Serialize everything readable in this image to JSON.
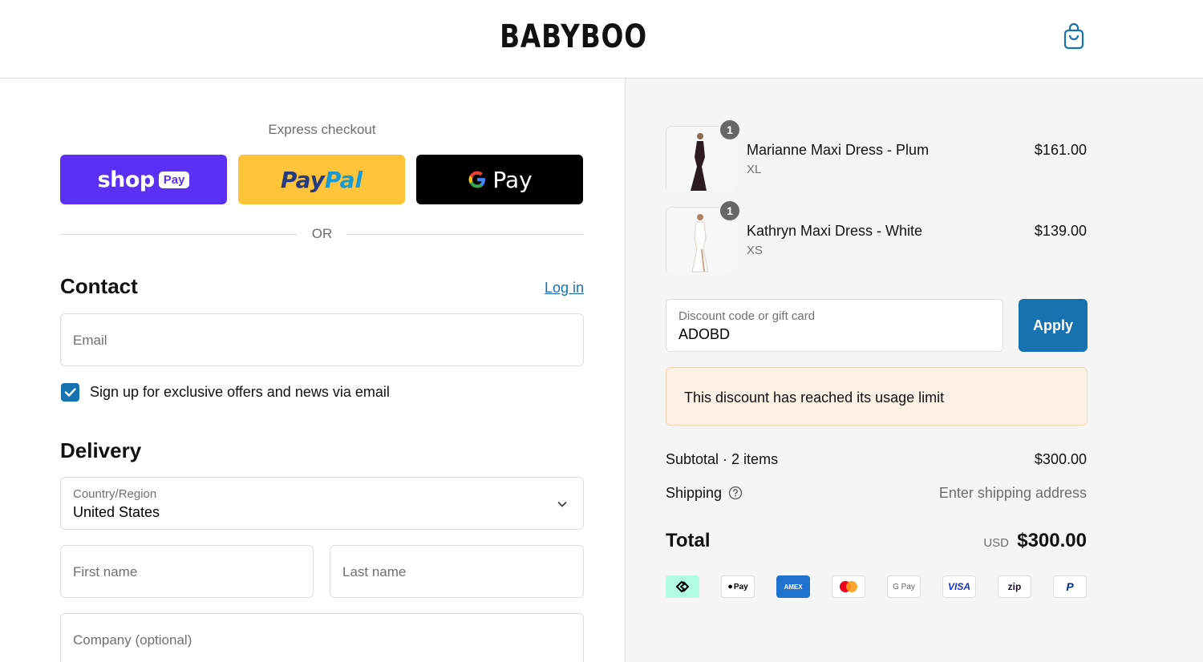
{
  "header": {
    "logo_text": "BABYBOO",
    "cart_icon": "shopping-bag-icon"
  },
  "express": {
    "title": "Express checkout",
    "shop_pay": {
      "word": "shop",
      "pill": "Pay"
    },
    "paypal": {
      "part1": "Pay",
      "part2": "Pal"
    },
    "gpay": {
      "g": "G",
      "word": "Pay"
    },
    "or_text": "OR"
  },
  "contact": {
    "title": "Contact",
    "login_link": "Log in",
    "email_placeholder": "Email",
    "newsletter_label": "Sign up for exclusive offers and news via email",
    "newsletter_checked": true
  },
  "delivery": {
    "title": "Delivery",
    "country_label": "Country/Region",
    "country_value": "United States",
    "first_name_placeholder": "First name",
    "last_name_placeholder": "Last name",
    "company_placeholder": "Company (optional)"
  },
  "cart": {
    "items": [
      {
        "name": "Marianne Maxi Dress - Plum",
        "variant": "XL",
        "price": "$161.00",
        "quantity": "1",
        "color": "#2b1a22"
      },
      {
        "name": "Kathryn Maxi Dress - White",
        "variant": "XS",
        "price": "$139.00",
        "quantity": "1",
        "color": "#f1f0ec"
      }
    ]
  },
  "discount": {
    "label": "Discount code or gift card",
    "value": "ADOBD",
    "apply_label": "Apply",
    "notice": "This discount has reached its usage limit"
  },
  "summary": {
    "subtotal_label": "Subtotal · 2 items",
    "subtotal_value": "$300.00",
    "shipping_label": "Shipping",
    "shipping_value": "Enter shipping address",
    "total_label": "Total",
    "total_currency": "USD",
    "total_value": "$300.00"
  },
  "payment_methods": [
    {
      "name": "afterpay",
      "label": ""
    },
    {
      "name": "apple-pay",
      "label": "Pay"
    },
    {
      "name": "amex",
      "label": "AMEX"
    },
    {
      "name": "mastercard",
      "label": ""
    },
    {
      "name": "google-pay",
      "label": "G Pay"
    },
    {
      "name": "visa",
      "label": "VISA"
    },
    {
      "name": "zip",
      "label": "zip"
    },
    {
      "name": "paypal",
      "label": "P"
    }
  ],
  "colors": {
    "accent": "#1773b0",
    "shop_pay": "#5a31f4",
    "paypal": "#ffc439",
    "notice_bg": "#fdf1e6"
  }
}
